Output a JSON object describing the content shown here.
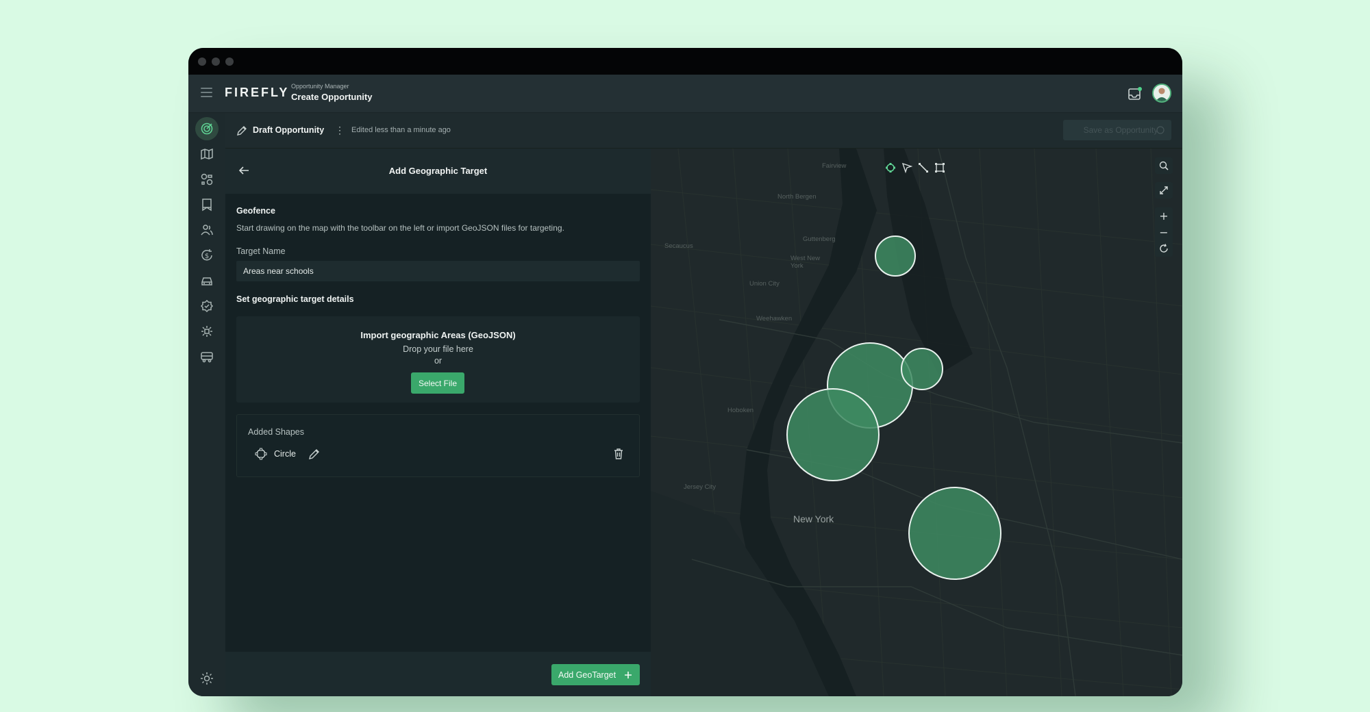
{
  "app": {
    "brand": "FIREFLY",
    "breadcrumb_parent": "Opportunity Manager",
    "breadcrumb_current": "Create Opportunity"
  },
  "sidebar": {
    "items": [
      {
        "icon": "target-icon",
        "active": true
      },
      {
        "icon": "map-icon"
      },
      {
        "icon": "shapes-icon"
      },
      {
        "icon": "bookmark-icon"
      },
      {
        "icon": "users-icon"
      },
      {
        "icon": "dollar-cycle-icon"
      },
      {
        "icon": "car-icon"
      },
      {
        "icon": "badge-icon"
      },
      {
        "icon": "focus-icon"
      },
      {
        "icon": "bus-icon"
      }
    ],
    "theme_icon": "sun-icon"
  },
  "subbar": {
    "draft_label": "Draft Opportunity",
    "kebab": "⋮",
    "edited_text": "Edited less than a minute ago",
    "save_label": "Save as Opportunity"
  },
  "panel": {
    "title": "Add Geographic Target",
    "geofence_title": "Geofence",
    "geofence_desc": "Start drawing on the map with the toolbar on the left or import GeoJSON files for targeting.",
    "target_name_label": "Target Name",
    "target_name_value": "Areas near schools",
    "set_details_title": "Set geographic target details",
    "import": {
      "title": "Import geographic Areas (GeoJSON)",
      "drop_text": "Drop your file here",
      "or_text": "or",
      "select_label": "Select File"
    },
    "added_shapes_title": "Added Shapes",
    "shapes": [
      {
        "name": "Circle"
      }
    ],
    "add_button_label": "Add GeoTarget"
  },
  "map": {
    "labels": [
      "Fairview",
      "North Bergen",
      "Secaucus",
      "Guttenberg",
      "West New York",
      "Union City",
      "Weehawken",
      "Hoboken",
      "Jersey City"
    ],
    "city_label": "New York",
    "zoom_in": "+",
    "zoom_out": "−"
  }
}
